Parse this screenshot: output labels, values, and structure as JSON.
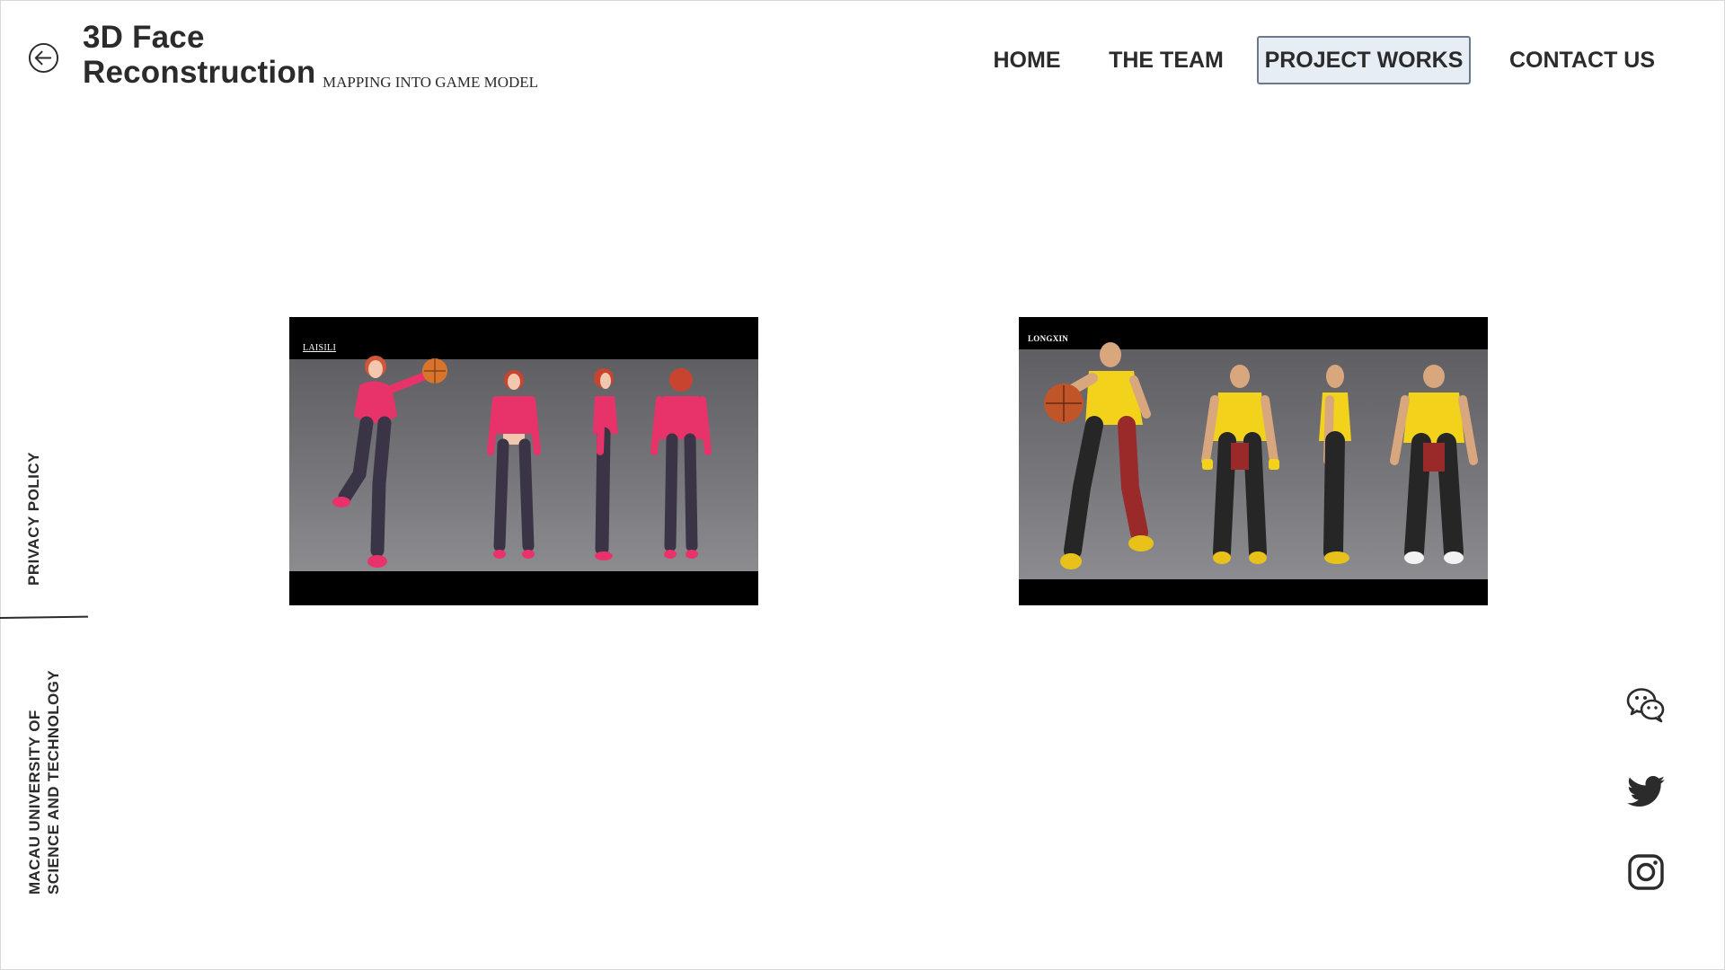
{
  "header": {
    "title_line1": "3D Face",
    "title_line2": "Reconstruction",
    "subtitle": "MAPPING INTO GAME MODEL",
    "back_icon": "arrow-left-circle-icon"
  },
  "nav": {
    "items": [
      {
        "label": "HOME",
        "active": false
      },
      {
        "label": "THE TEAM",
        "active": false
      },
      {
        "label": "PROJECT WORKS",
        "active": true
      },
      {
        "label": "CONTACT US",
        "active": false
      }
    ]
  },
  "sidebar": {
    "privacy_label": "PRIVACY POLICY",
    "university_line1": "MACAU UNIVERSITY OF",
    "university_line2": "SCIENCE AND TECHNOLOGY"
  },
  "gallery": {
    "items": [
      {
        "caption": "LAISILI",
        "subject": "female basketball character turnaround",
        "accent": "#e8336a"
      },
      {
        "caption": "LONGXIN",
        "subject": "male basketball character turnaround",
        "accent": "#f2d21b"
      }
    ]
  },
  "social": {
    "icons": [
      "wechat-icon",
      "twitter-icon",
      "instagram-icon"
    ]
  },
  "colors": {
    "text": "#2b2b2b",
    "active_nav_bg": "#e6edf5",
    "active_nav_border": "#6b7a8a"
  }
}
